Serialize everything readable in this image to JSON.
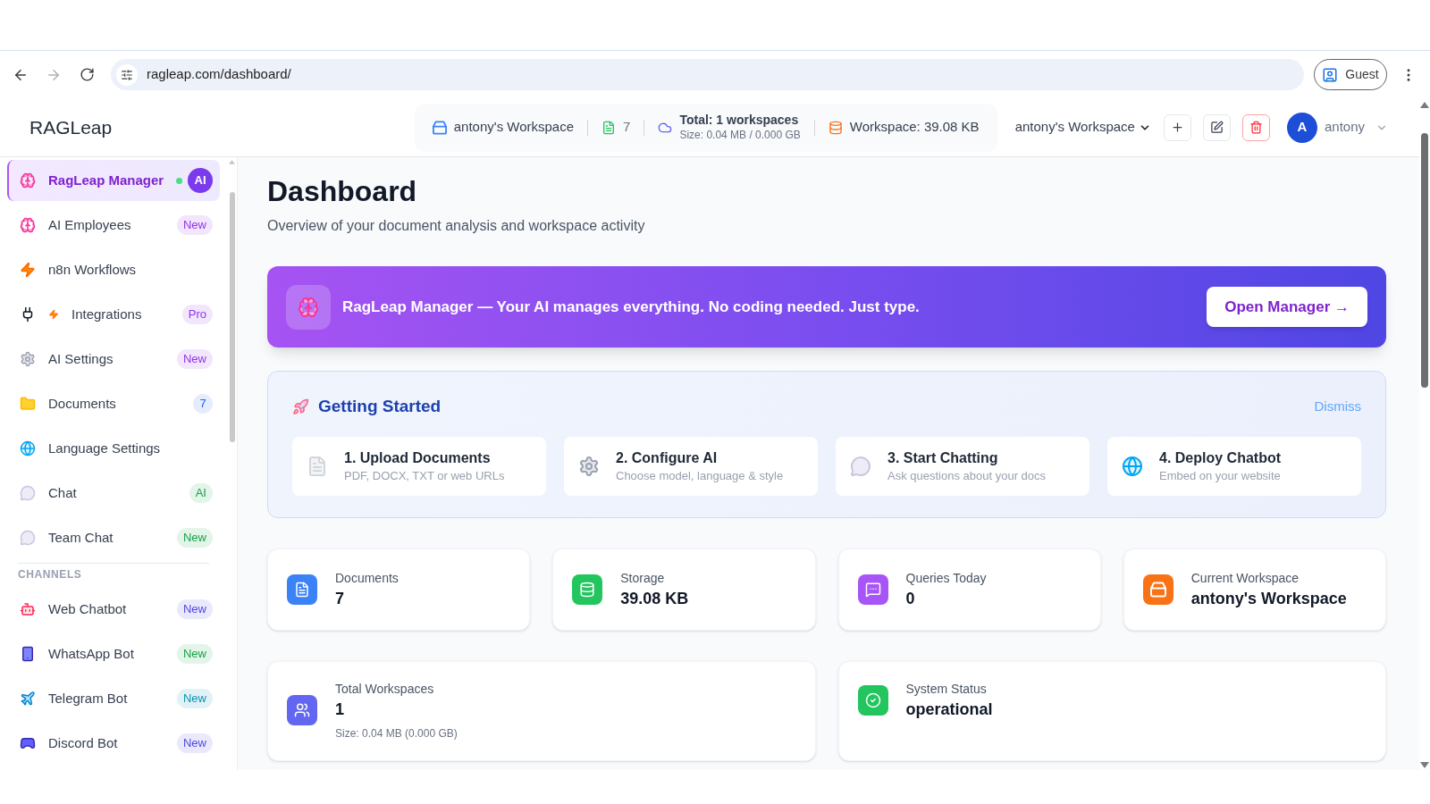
{
  "browser": {
    "url": "ragleap.com/dashboard/",
    "profile": "Guest"
  },
  "header": {
    "brand": "RAGLeap",
    "stats": [
      {
        "text": "antony's Workspace"
      },
      {
        "text": "7"
      },
      {
        "text": "Total: 1 workspaces",
        "subtext": "Size: 0.04 MB / 0.000 GB"
      },
      {
        "text": "Workspace: 39.08 KB"
      }
    ],
    "workspace_select": {
      "value": "antony's Workspace"
    },
    "user": {
      "initial": "A",
      "name": "antony"
    }
  },
  "sidebar": {
    "items": [
      {
        "label": "RagLeap Manager",
        "selected": true,
        "online": true,
        "badge": {
          "text": "AI",
          "kind": "solid",
          "color": "#7c3aed"
        }
      },
      {
        "label": "AI Employees",
        "selected": false,
        "online": false,
        "badge": {
          "text": "New",
          "kind": "soft",
          "color": "#9333ea"
        }
      },
      {
        "label": "n8n Workflows",
        "selected": false,
        "online": false
      },
      {
        "label": "Integrations",
        "selected": false,
        "online": false,
        "badge": {
          "text": "Pro",
          "kind": "soft",
          "color": "#9333ea"
        }
      },
      {
        "label": "AI Settings",
        "selected": false,
        "online": false,
        "badge": {
          "text": "New",
          "kind": "soft",
          "color": "#9333ea"
        }
      },
      {
        "label": "Documents",
        "selected": false,
        "online": false,
        "badge": {
          "text": "7",
          "kind": "soft",
          "color": "#2563eb"
        }
      },
      {
        "label": "Language Settings",
        "selected": false,
        "online": false
      },
      {
        "label": "Chat",
        "selected": false,
        "online": false,
        "badge": {
          "text": "AI",
          "kind": "soft",
          "color": "#16a34a"
        }
      },
      {
        "label": "Team Chat",
        "selected": false,
        "online": false,
        "badge": {
          "text": "New",
          "kind": "soft",
          "color": "#16a34a"
        }
      }
    ],
    "channels": {
      "heading": "CHANNELS",
      "items": [
        {
          "label": "Web Chatbot",
          "selected": false,
          "online": false,
          "badge": {
            "text": "New",
            "kind": "soft",
            "color": "#4f46e5"
          }
        },
        {
          "label": "WhatsApp Bot",
          "selected": false,
          "online": false,
          "badge": {
            "text": "New",
            "kind": "soft",
            "color": "#16a34a"
          }
        },
        {
          "label": "Telegram Bot",
          "selected": false,
          "online": false,
          "badge": {
            "text": "New",
            "kind": "soft",
            "color": "#0891b2"
          }
        },
        {
          "label": "Discord Bot",
          "selected": false,
          "online": false,
          "badge": {
            "text": "New",
            "kind": "soft",
            "color": "#4f46e5"
          }
        }
      ]
    }
  },
  "page": {
    "title": "Dashboard",
    "subtitle": "Overview of your document analysis and workspace activity"
  },
  "banner": {
    "text": "RagLeap Manager — Your AI manages everything. No coding needed. Just type.",
    "button": "Open Manager →"
  },
  "getting_started": {
    "title": "Getting Started",
    "dismiss": "Dismiss",
    "steps": [
      {
        "title": "1. Upload Documents",
        "description": "PDF, DOCX, TXT or web URLs"
      },
      {
        "title": "2. Configure AI",
        "description": "Choose model, language & style"
      },
      {
        "title": "3. Start Chatting",
        "description": "Ask questions about your docs"
      },
      {
        "title": "4. Deploy Chatbot",
        "description": "Embed on your website"
      }
    ]
  },
  "stats": [
    {
      "label": "Documents",
      "value": "7"
    },
    {
      "label": "Storage",
      "value": "39.08 KB"
    },
    {
      "label": "Queries Today",
      "value": "0"
    },
    {
      "label": "Current Workspace",
      "value": "antony's Workspace"
    }
  ],
  "summary": [
    {
      "label": "Total Workspaces",
      "value": "1",
      "note": "Size: 0.04 MB (0.000 GB)"
    },
    {
      "label": "System Status",
      "value": "operational"
    }
  ]
}
